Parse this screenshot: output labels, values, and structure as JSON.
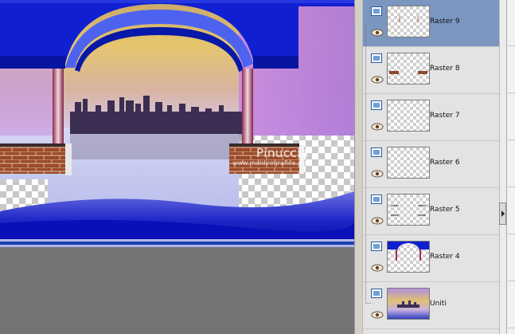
{
  "canvas": {
    "watermark_title": "Pinuccia",
    "watermark_url": "www.maidiregrafica.eu"
  },
  "layers": [
    {
      "name": "Raster 9",
      "selected": true,
      "thumb": "empty"
    },
    {
      "name": "Raster 8",
      "selected": false,
      "thumb": "brown-dashes"
    },
    {
      "name": "Raster 7",
      "selected": false,
      "thumb": "empty"
    },
    {
      "name": "Raster 6",
      "selected": false,
      "thumb": "empty"
    },
    {
      "name": "Raster 5",
      "selected": false,
      "thumb": "dark-dashes"
    },
    {
      "name": "Raster 4",
      "selected": false,
      "thumb": "blue-arch"
    },
    {
      "name": "Uniti",
      "selected": false,
      "thumb": "scene"
    }
  ],
  "icons": {
    "layer_type": "raster-layer-icon",
    "visibility": "eye-icon",
    "scroll": "scroll-right-arrow-icon"
  },
  "colors": {
    "selected_row": "#7b97c0",
    "panel_bg": "#e3e3e3",
    "canvas_bg": "#747474"
  }
}
